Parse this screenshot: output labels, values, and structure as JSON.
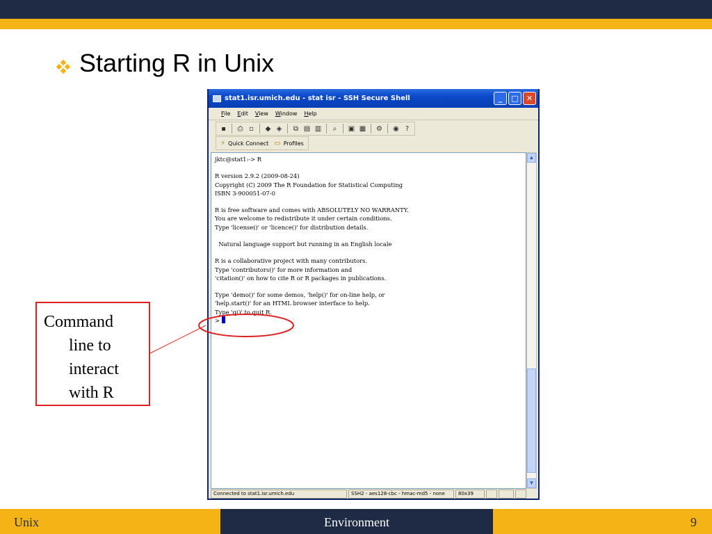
{
  "slide": {
    "title": "Starting R in Unix",
    "bullet_icon": "diamond-bullet-icon",
    "colors": {
      "navy": "#1f2a44",
      "gold": "#f5b316",
      "callout_red": "#e02020"
    }
  },
  "callout": {
    "line1": "Command",
    "line2": "line to",
    "line3": "interact",
    "line4": "with R"
  },
  "window": {
    "title": "stat1.isr.umich.edu - stat isr - SSH Secure Shell",
    "menu": [
      "File",
      "Edit",
      "View",
      "Window",
      "Help"
    ],
    "quick_connect": "Quick Connect",
    "profiles": "Profiles",
    "terminal_text": "jktc@stat1:-> R\n\nR version 2.9.2 (2009-08-24)\nCopyright (C) 2009 The R Foundation for Statistical Computing\nISBN 3-900051-07-0\n\nR is free software and comes with ABSOLUTELY NO WARRANTY.\nYou are welcome to redistribute it under certain conditions.\nType 'license()' or 'licence()' for distribution details.\n\n  Natural language support but running in an English locale\n\nR is a collaborative project with many contributors.\nType 'contributors()' for more information and\n'citation()' on how to cite R or R packages in publications.\n\nType 'demo()' for some demos, 'help()' for on-line help, or\n'help.start()' for an HTML browser interface to help.\nType 'q()' to quit R.\n",
    "prompt": "> ",
    "status": {
      "connection": "Connected to stat1.isr.umich.edu",
      "cipher": "SSH2 - aes128-cbc - hmac-md5 - none",
      "size": "80x39"
    }
  },
  "footer": {
    "left": "Unix",
    "middle": "Environment",
    "page": "9"
  }
}
